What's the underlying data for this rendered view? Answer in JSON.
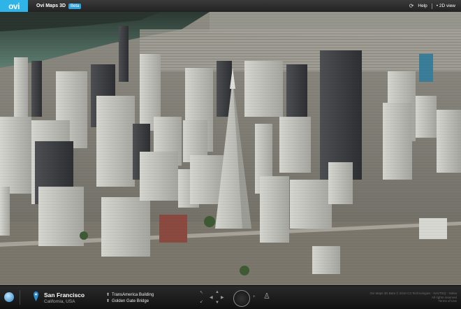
{
  "header": {
    "logo_text": "ovi",
    "app_title": "Ovi Maps 3D",
    "beta_label": "Beta",
    "help_label": "Help",
    "view_toggle_label": "• 2D view"
  },
  "location": {
    "name": "San Francisco",
    "country": "California, USA"
  },
  "nearby": [
    {
      "label": "TransAmerica Building"
    },
    {
      "label": "Golden Gate Bridge"
    }
  ],
  "footer": {
    "copyright_1": "Ovi Maps 3D Beta © 2010 C3 Technologies · NAVTEQ · Nokia",
    "copyright_2": "All rights reserved",
    "copyright_3": "Terms of Use"
  },
  "colors": {
    "brand": "#2fb4e8",
    "topbar": "#2c2c2c",
    "water": "#5a7a6e",
    "buildings": "#b9b9b4"
  },
  "icons": {
    "logo": "ovi-logo",
    "globe": "globe-icon",
    "pin": "location-pin-icon",
    "person": "street-view-person-icon"
  }
}
